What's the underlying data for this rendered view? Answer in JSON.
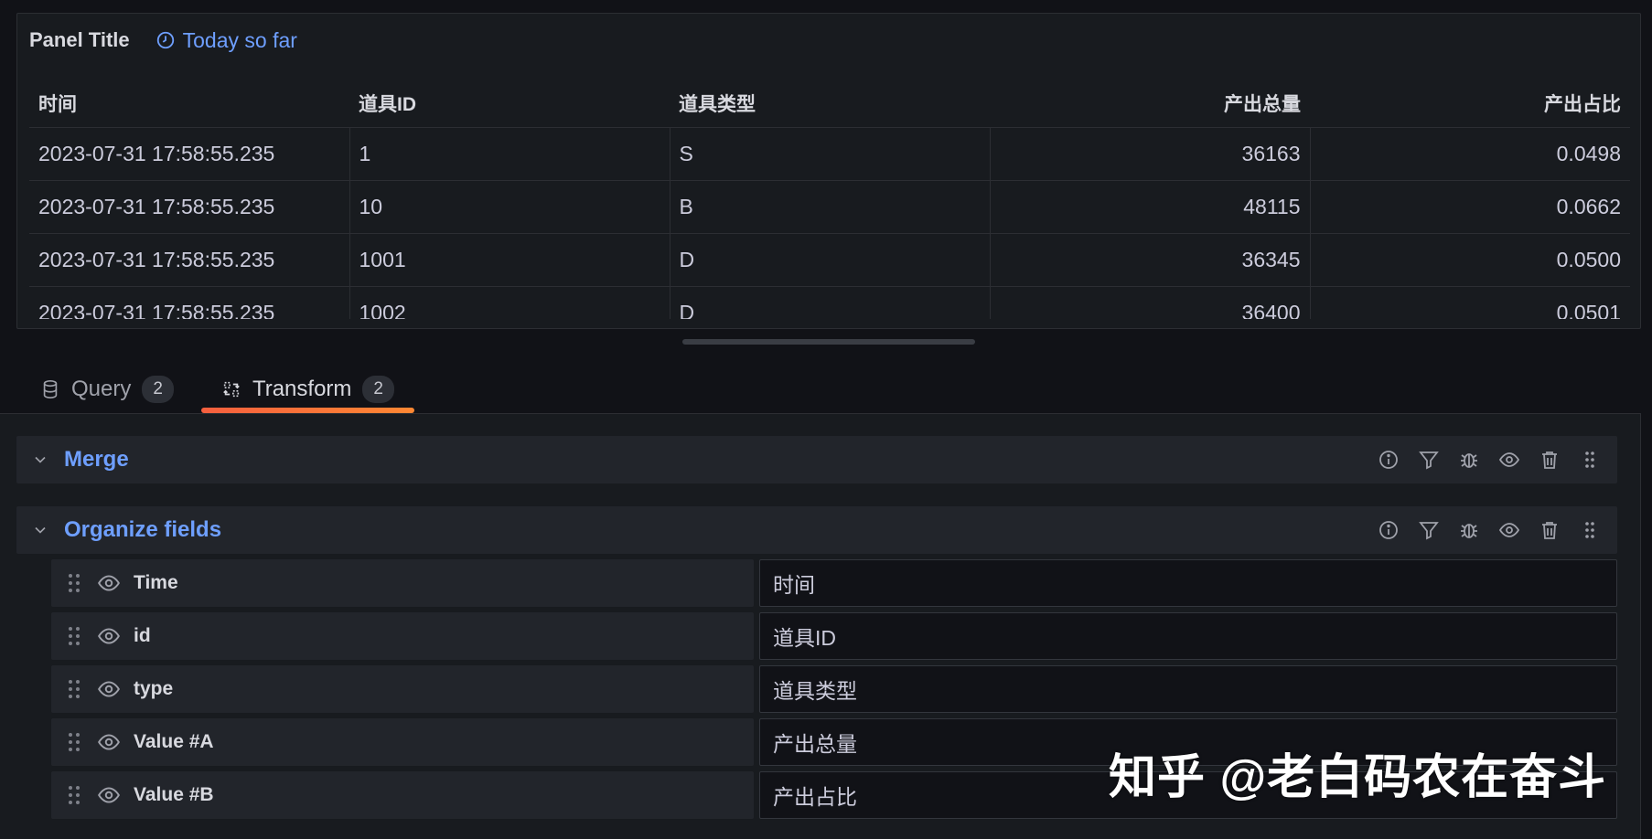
{
  "panel": {
    "title": "Panel Title",
    "time_info": "Today so far",
    "table": {
      "columns": [
        "时间",
        "道具ID",
        "道具类型",
        "产出总量",
        "产出占比"
      ],
      "rows": [
        [
          "2023-07-31 17:58:55.235",
          "1",
          "S",
          "36163",
          "0.0498"
        ],
        [
          "2023-07-31 17:58:55.235",
          "10",
          "B",
          "48115",
          "0.0662"
        ],
        [
          "2023-07-31 17:58:55.235",
          "1001",
          "D",
          "36345",
          "0.0500"
        ],
        [
          "2023-07-31 17:58:55.235",
          "1002",
          "D",
          "36400",
          "0.0501"
        ]
      ]
    }
  },
  "tabs": [
    {
      "label": "Query",
      "count": "2",
      "active": false
    },
    {
      "label": "Transform",
      "count": "2",
      "active": true
    }
  ],
  "transformations": [
    {
      "name": "Merge",
      "expanded": false
    },
    {
      "name": "Organize fields",
      "expanded": true,
      "fields": [
        {
          "name": "Time",
          "rename": "时间"
        },
        {
          "name": "id",
          "rename": "道具ID"
        },
        {
          "name": "type",
          "rename": "道具类型"
        },
        {
          "name": "Value #A",
          "rename": "产出总量"
        },
        {
          "name": "Value #B",
          "rename": "产出占比"
        }
      ]
    }
  ],
  "watermark": "知乎 @老白码农在奋斗",
  "colors": {
    "background": "#111217",
    "panel": "#181b1f",
    "accent_blue": "#6e9fff",
    "tab_underline": "#ff6633"
  }
}
